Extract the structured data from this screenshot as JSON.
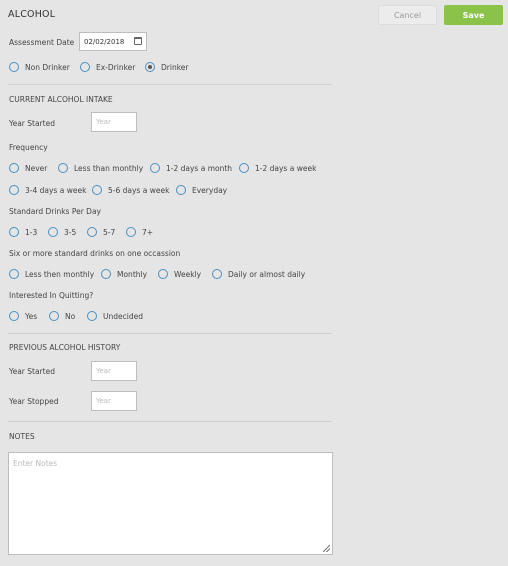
{
  "header": {
    "title": "ALCOHOL",
    "cancel_label": "Cancel",
    "save_label": "Save"
  },
  "assessment": {
    "label": "Assessment Date",
    "date_value": "02/02/2018"
  },
  "status": {
    "options": [
      "Non Drinker",
      "Ex-Drinker",
      "Drinker"
    ],
    "selected": "Drinker"
  },
  "current": {
    "heading": "CURRENT ALCOHOL INTAKE",
    "year_started_label": "Year Started",
    "year_placeholder": "Year",
    "frequency_label": "Frequency",
    "frequency_options": [
      "Never",
      "Less than monthly",
      "1-2 days a month",
      "1-2 days a week",
      "3-4 days a week",
      "5-6 days a week",
      "Everyday"
    ],
    "standard_drinks_label": "Standard Drinks Per Day",
    "standard_drinks_options": [
      "1-3",
      "3-5",
      "5-7",
      "7+"
    ],
    "six_or_more_label": "Six or more standard drinks on one occassion",
    "six_or_more_options": [
      "Less then monthly",
      "Monthly",
      "Weekly",
      "Daily or almost daily"
    ],
    "quitting_label": "Interested In Quitting?",
    "quitting_options": [
      "Yes",
      "No",
      "Undecided"
    ]
  },
  "previous": {
    "heading": "PREVIOUS ALCOHOL HISTORY",
    "year_started_label": "Year Started",
    "year_stopped_label": "Year Stopped",
    "year_placeholder": "Year"
  },
  "notes": {
    "heading": "NOTES",
    "placeholder": "Enter Notes"
  },
  "colors": {
    "save": "#8bc34a",
    "radio_border": "#4a90c2",
    "background": "#e5e5e5"
  }
}
